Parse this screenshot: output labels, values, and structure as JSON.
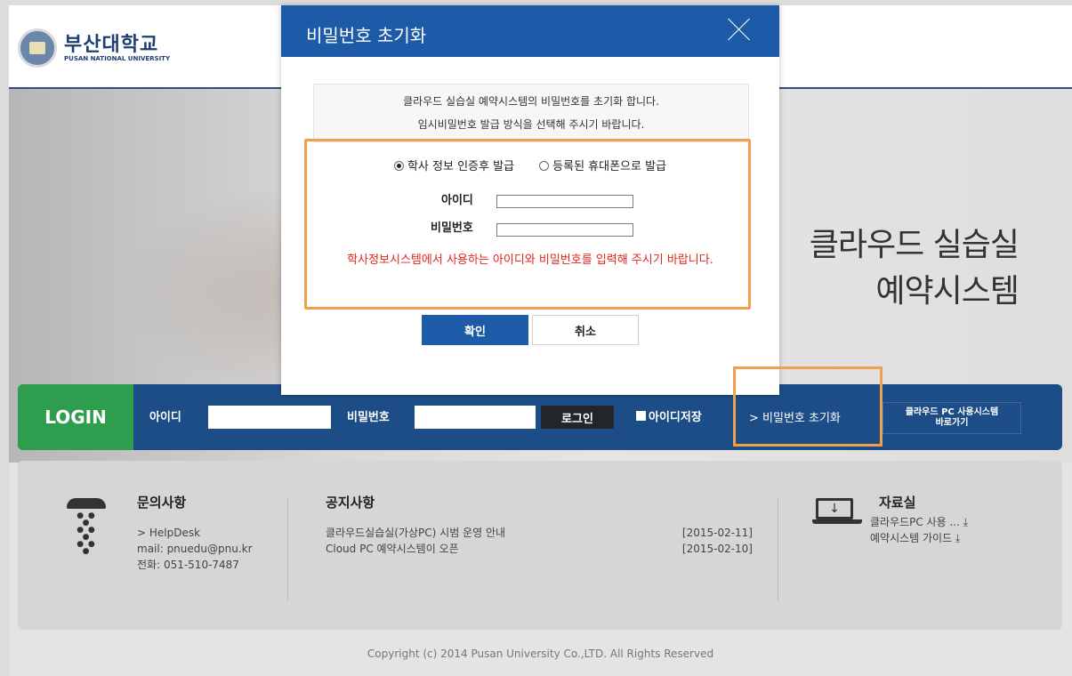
{
  "header": {
    "logo_ko": "부산대학교",
    "logo_en": "PUSAN NATIONAL UNIVERSITY"
  },
  "hero": {
    "line1": "클라우드 실습실",
    "line2": "예약시스템"
  },
  "login": {
    "label": "LOGIN",
    "id_label": "아이디",
    "pw_label": "비밀번호",
    "login_button": "로그인",
    "remember_label": "아이디저장",
    "reset_link": "> 비밀번호 초기화",
    "cloud_btn_line1": "클라우드 PC 사용시스템",
    "cloud_btn_line2": "바로가기"
  },
  "info": {
    "contact": {
      "title": "문의사항",
      "line1": "> HelpDesk",
      "line2": "mail: pnuedu@pnu.kr",
      "line3": "전화: 051-510-7487"
    },
    "notices": {
      "title": "공지사항",
      "items": [
        {
          "text": "클라우드실습실(가상PC) 시범 운영 안내",
          "date": "[2015-02-11]"
        },
        {
          "text": "Cloud PC 예약시스템이 오픈",
          "date": "[2015-02-10]"
        }
      ]
    },
    "resources": {
      "title": "자료실",
      "item1": "클라우드PC 사용 ... ⤓",
      "item2": "예약시스템 가이드 ⤓"
    }
  },
  "copyright": "Copyright (c) 2014 Pusan University Co.,LTD. All Rights Reserved",
  "modal": {
    "title": "비밀번호 초기화",
    "notice_line1": "클라우드 실습실 예약시스템의 비밀번호를 초기화 합니다.",
    "notice_line2": "임시비밀번호 발급 방식을 선택해 주시기 바랍니다.",
    "option1": "학사 정보 인증후 발급",
    "option2": "등록된 휴대폰으로 발급",
    "id_label": "아이디",
    "pw_label": "비밀번호",
    "warning": "학사정보시스템에서 사용하는 아이디와 비밀번호를 입력해 주시기 바랍니다.",
    "confirm": "확인",
    "cancel": "취소"
  },
  "colors": {
    "primary_blue": "#1d5ba8",
    "login_bar": "#1d4d86",
    "login_green": "#2e9d4e",
    "warning_red": "#e0261d",
    "highlight_orange": "#f0a04b"
  }
}
